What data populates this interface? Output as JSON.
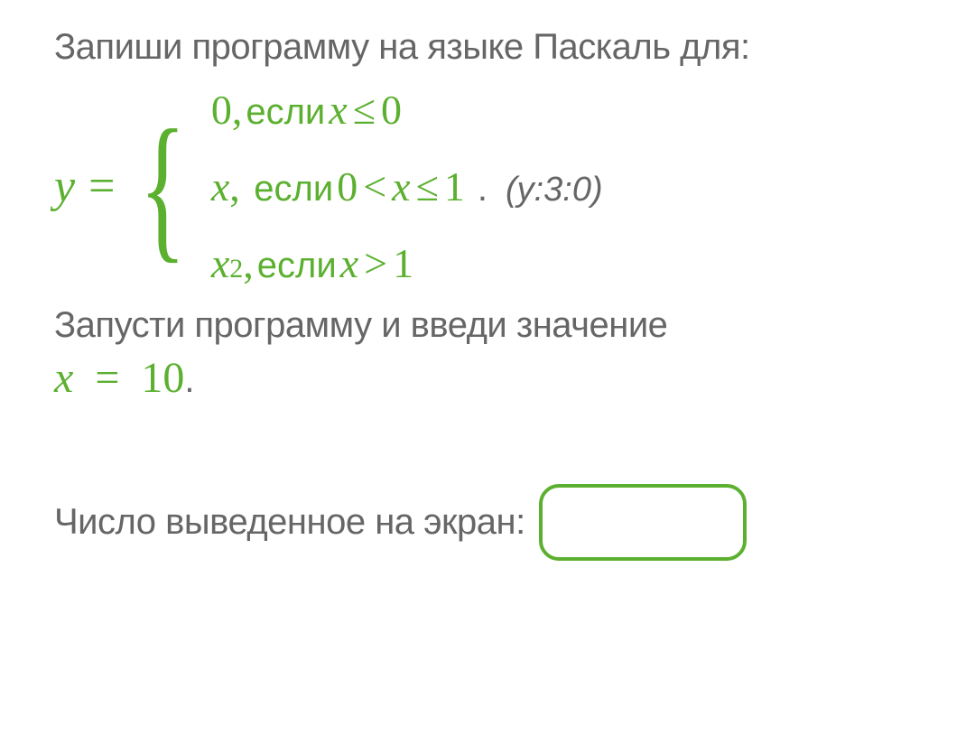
{
  "instruction": "Запиши программу на языке Паскаль для:",
  "formula": {
    "lhs_var": "y",
    "equals": "=",
    "cases": [
      {
        "value": "0",
        "esli": "если",
        "cond_var": "x",
        "cond_op": "≤",
        "cond_val": "0"
      },
      {
        "value": "x",
        "esli": "если",
        "cond_left": "0",
        "cond_op1": "<",
        "cond_var": "x",
        "cond_op2": "≤",
        "cond_right": "1"
      },
      {
        "value_base": "x",
        "value_exp": "2",
        "esli": "если",
        "cond_var": "x",
        "cond_op": ">",
        "cond_val": "1"
      }
    ]
  },
  "format_note": "(y:3:0)",
  "run_instruction": "Запусти программу и введи значение",
  "x_assignment": {
    "var": "x",
    "equals": "=",
    "val": "10"
  },
  "answer_label": "Число выведенное на экран:",
  "answer_value": "",
  "answer_placeholder": ""
}
